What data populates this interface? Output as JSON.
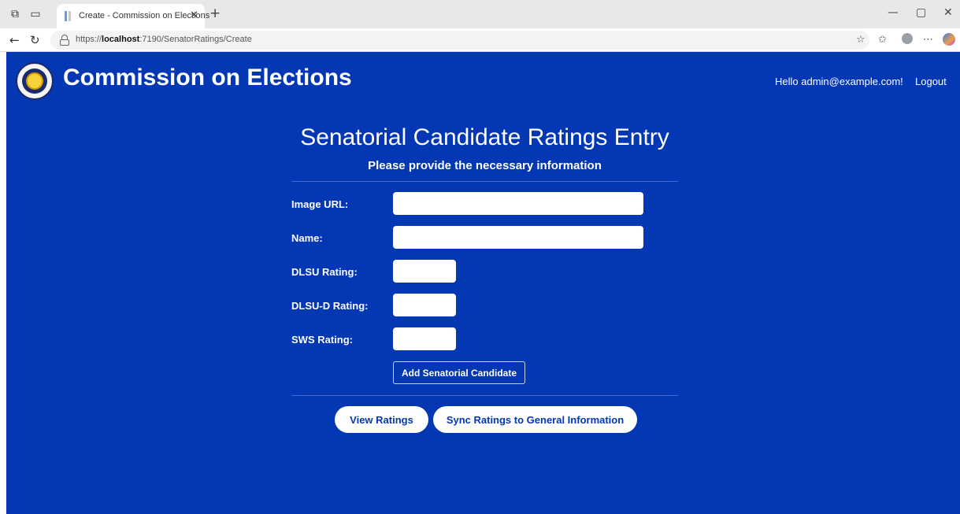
{
  "browser": {
    "tab_title": "Create - Commission on Elections",
    "url_prefix": "https://",
    "url_host": "localhost",
    "url_path": ":7190/SenatorRatings/Create"
  },
  "header": {
    "brand": "Commission on Elections",
    "greeting": "Hello admin@example.com!",
    "logout": "Logout"
  },
  "form": {
    "title": "Senatorial Candidate Ratings Entry",
    "subtitle": "Please provide the necessary information",
    "fields": [
      {
        "label": "Image URL:",
        "value": ""
      },
      {
        "label": "Name:",
        "value": ""
      },
      {
        "label": "DLSU Rating:",
        "value": ""
      },
      {
        "label": "DLSU-D Rating:",
        "value": ""
      },
      {
        "label": "SWS Rating:",
        "value": ""
      }
    ],
    "submit_label": "Add Senatorial Candidate"
  },
  "actions": {
    "view_ratings": "View Ratings",
    "sync_ratings": "Sync Ratings to General Information"
  }
}
